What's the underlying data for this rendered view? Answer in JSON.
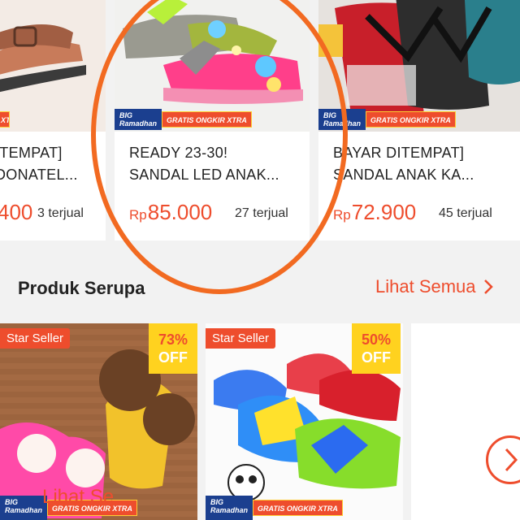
{
  "top_products": [
    {
      "name": "ITEMPAT]\nDONATEL...",
      "price_prefix": "",
      "price": "400",
      "sold": "3 terjual"
    },
    {
      "name": "READY 23-30!\nSANDAL LED ANAK...",
      "price_prefix": "Rp",
      "price": "85.000",
      "sold": "27 terjual"
    },
    {
      "name": "BAYAR DITEMPAT]\nSANDAL ANAK KA...",
      "price_prefix": "Rp",
      "price": "72.900",
      "sold": "45 terjual"
    }
  ],
  "promo": {
    "big": "BIG",
    "ramadhan": "Ramadhan",
    "gratis": "GRATIS ONGKIR",
    "xtra": "XTRA"
  },
  "section": {
    "title": "Produk Serupa",
    "see_all": "Lihat Semua"
  },
  "similar": [
    {
      "badge": "Star Seller",
      "discount": "73%",
      "off": "OFF"
    },
    {
      "badge": "Star Seller",
      "discount": "50%",
      "off": "OFF"
    }
  ],
  "more": {
    "label": "Lihat Se"
  },
  "colors": {
    "accent": "#ee4d2d",
    "promo_blue": "#1b3f8f",
    "badge_yellow": "#ffd21f",
    "highlight_circle": "#f26a21"
  },
  "icons": {
    "see_all": "chevron-right-icon",
    "more": "chevron-right-circle-icon"
  }
}
